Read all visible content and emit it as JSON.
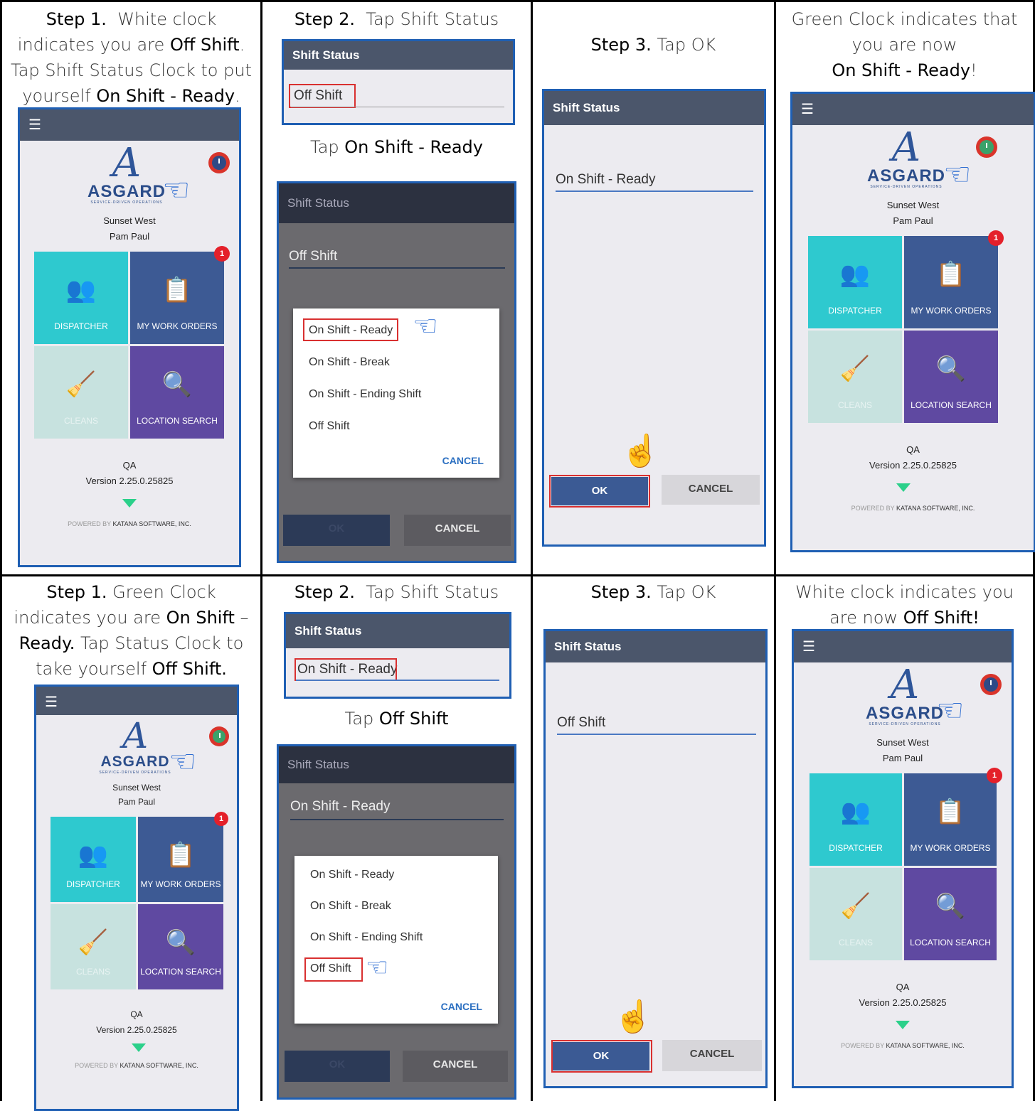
{
  "row1": {
    "c1": {
      "step": "Step 1.",
      "text1": "White clock",
      "text2": "indicates you are",
      "b1": "Off Shift",
      "text3": ".",
      "text4": "Tap Shift Status Clock to put",
      "text5": "yourself",
      "b2": "On Shift - Ready",
      "text6": "."
    },
    "c2": {
      "step": "Step 2.",
      "text": "Tap Shift Status",
      "tap_pre": "Tap",
      "tap_target": "On Shift - Ready"
    },
    "c3": {
      "step": "Step 3.",
      "text": "Tap OK"
    },
    "c4": {
      "text1": "Green Clock indicates that",
      "text2": "you are now",
      "b1": "On Shift - Ready",
      "text3": "!"
    }
  },
  "row2": {
    "c1": {
      "step": "Step 1.",
      "text1": "Green Clock",
      "text2": "indicates you are",
      "b1": "On Shift",
      "text3": " –",
      "b2": "Ready.",
      "text4": "Tap Status Clock to",
      "text5": "take yourself",
      "b3": "Off Shift."
    },
    "c2": {
      "step": "Step 2.",
      "text": "Tap Shift Status",
      "tap_pre": "Tap",
      "tap_target": "Off Shift"
    },
    "c3": {
      "step": "Step 3.",
      "text": "Tap OK"
    },
    "c4": {
      "text1": "White clock indicates you",
      "text2": "are now",
      "b1": "Off Shift!"
    }
  },
  "app": {
    "logo_word": "ASGARD",
    "logo_tag": "SERVICE-DRIVEN OPERATIONS",
    "location": "Sunset West",
    "user": "Pam Paul",
    "tiles": {
      "dispatcher": "DISPATCHER",
      "work_orders": "MY WORK ORDERS",
      "cleans": "CLEANS",
      "location_search": "LOCATION SEARCH"
    },
    "badge": "1",
    "env": "QA",
    "version": "Version 2.25.0.25825",
    "powered_by": "POWERED BY",
    "company": "KATANA SOFTWARE, INC.",
    "menu_icon": "hamburger-icon",
    "colors": {
      "clock_off": "#2e4a86",
      "clock_on": "#3aa26a",
      "clock_ring": "#d9342b"
    }
  },
  "dialog": {
    "title": "Shift Status",
    "off_shift": "Off Shift",
    "on_shift_ready": "On Shift - Ready",
    "options": [
      "On Shift - Ready",
      "On Shift - Break",
      "On Shift - Ending Shift",
      "Off Shift"
    ],
    "cancel_menu": "CANCEL",
    "ok": "OK",
    "cancel": "CANCEL"
  }
}
